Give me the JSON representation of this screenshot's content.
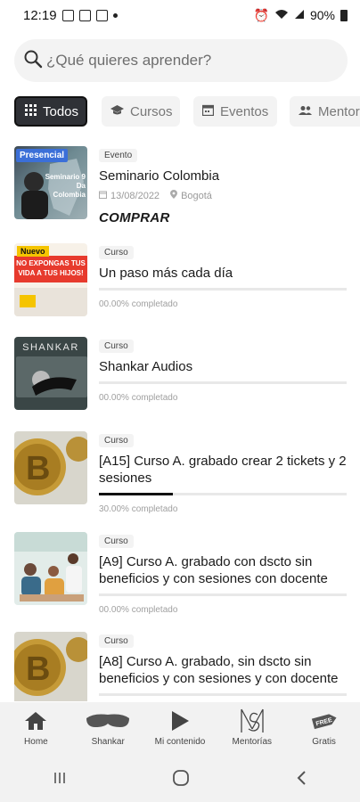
{
  "status": {
    "time": "12:19",
    "battery": "90%"
  },
  "search": {
    "placeholder": "¿Qué quieres aprender?"
  },
  "chips": [
    {
      "label": "Todos",
      "icon": "grid-icon"
    },
    {
      "label": "Cursos",
      "icon": "graduation-cap-icon"
    },
    {
      "label": "Eventos",
      "icon": "calendar-icon"
    },
    {
      "label": "Mentor",
      "icon": "people-icon"
    }
  ],
  "items": [
    {
      "tag": "Evento",
      "title": "Seminario Colombia",
      "date": "13/08/2022",
      "location": "Bogotá",
      "action": "COMPRAR",
      "thumb_badge": "Presencial",
      "thumb_text": "Seminario 9 Da\nColombia"
    },
    {
      "tag": "Curso",
      "title": "Un paso más cada día",
      "progress_text": "00.00% completado",
      "progress": 0,
      "thumb_badge": "Nuevo",
      "thumb_text": "NO EXPONGAS TUS\nVIDA A TUS HIJOS!"
    },
    {
      "tag": "Curso",
      "title": "Shankar Audios",
      "progress_text": "00.00% completado",
      "progress": 0,
      "thumb_text": "SHANKAR"
    },
    {
      "tag": "Curso",
      "title": "[A15] Curso A. grabado crear 2 tickets y 2 sesiones",
      "progress_text": "30.00% completado",
      "progress": 0.3
    },
    {
      "tag": "Curso",
      "title": "[A9] Curso A. grabado con dscto sin beneficios y con sesiones con docente",
      "progress_text": "00.00% completado",
      "progress": 0
    },
    {
      "tag": "Curso",
      "title": "[A8] Curso A. grabado, sin dscto sin beneficios y con sesiones y con docente",
      "progress": 0
    }
  ],
  "nav": [
    {
      "label": "Home",
      "icon": "home-icon"
    },
    {
      "label": "Shankar",
      "icon": "sleep-mask-icon"
    },
    {
      "label": "Mi contenido",
      "icon": "play-icon"
    },
    {
      "label": "Mentorías",
      "icon": "monogram-icon"
    },
    {
      "label": "Gratis",
      "icon": "free-tag-icon"
    }
  ],
  "colors": {
    "active_chip": "#2f3136",
    "badge_blue": "#3b6fd8",
    "badge_yellow": "#f5c400"
  }
}
